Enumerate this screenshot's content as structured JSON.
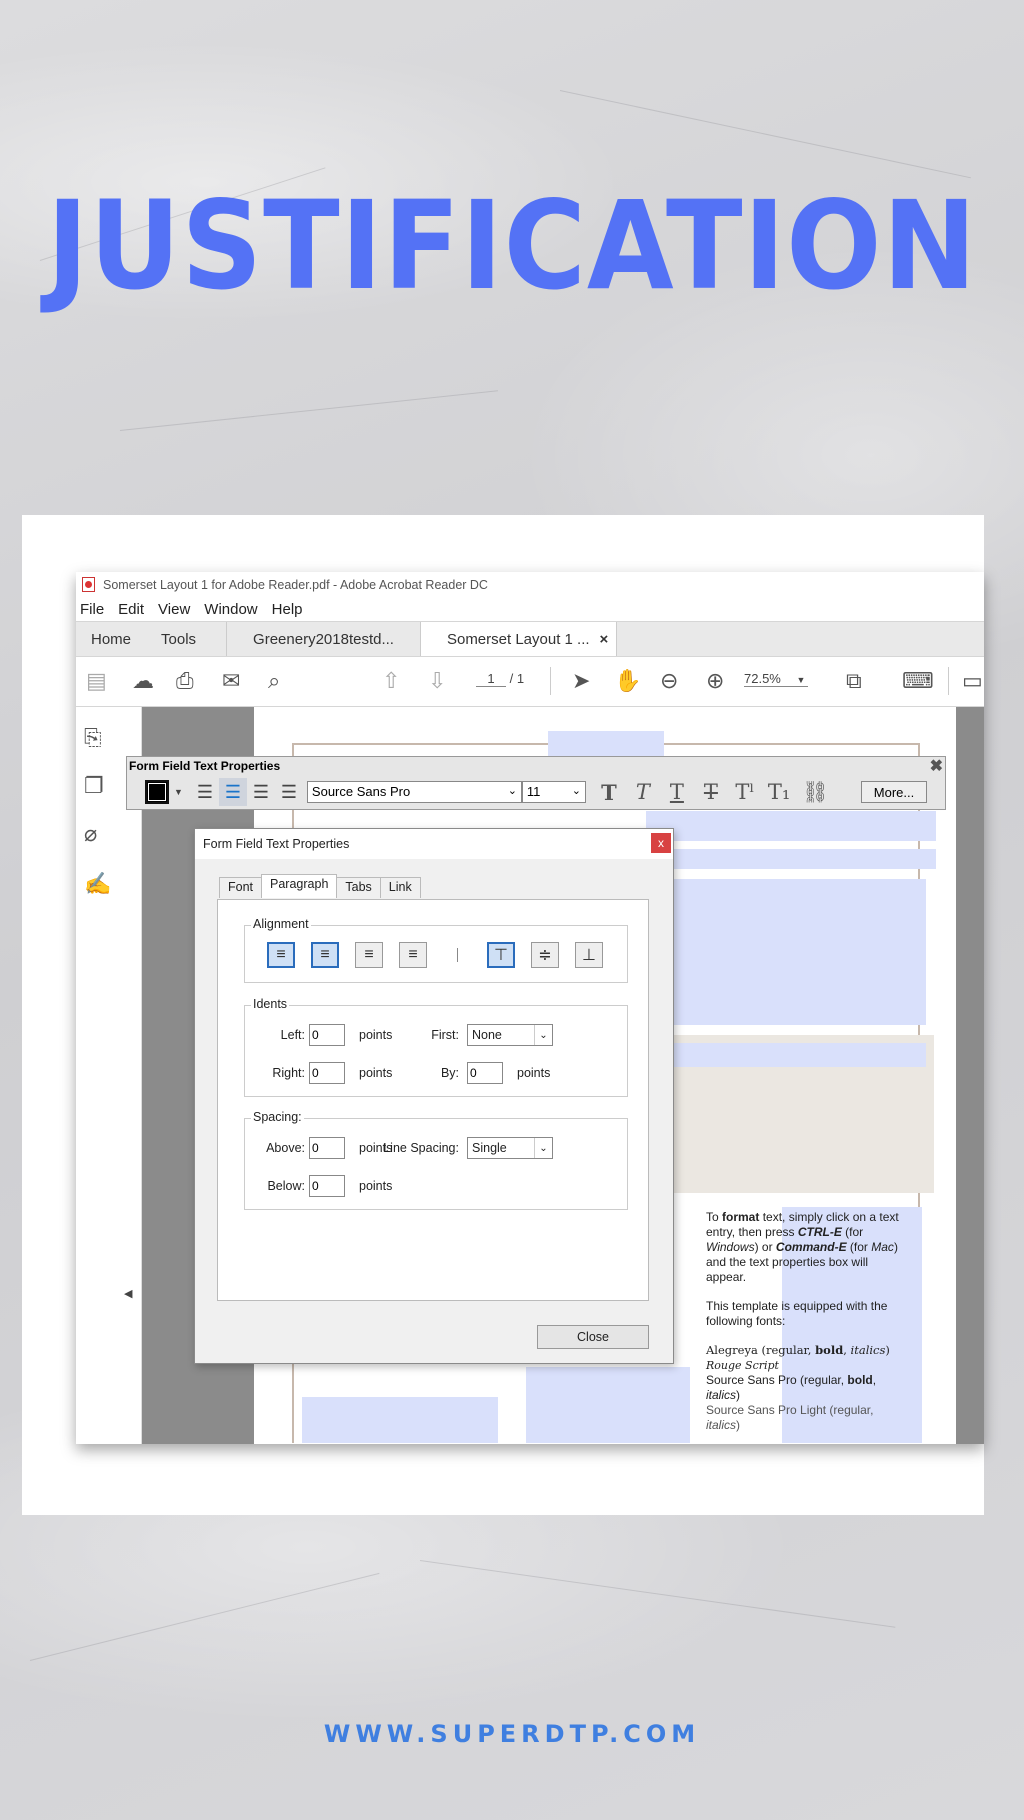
{
  "headline": "JUSTIFICATION",
  "footer_url": "WWW.SUPERDTP.COM",
  "colors": {
    "headline": "#5472f5",
    "footer": "#3f7fe0",
    "accent_blue": "#1a73c9",
    "field_fill": "#d9e0fb"
  },
  "window": {
    "title": "Somerset Layout 1 for Adobe Reader.pdf - Adobe Acrobat Reader DC",
    "menu": [
      "File",
      "Edit",
      "View",
      "Window",
      "Help"
    ],
    "tabs": {
      "home": "Home",
      "tools": "Tools",
      "doc1": "Greenery2018testd...",
      "doc2": "Somerset Layout 1 ...",
      "close": "×"
    },
    "toolbar": {
      "page_current": "1",
      "page_total": "/ 1",
      "zoom": "72.5%"
    }
  },
  "text_toolbar": {
    "title": "Form Field Text Properties",
    "font": "Source Sans Pro",
    "size": "11",
    "more": "More..."
  },
  "dialog": {
    "title": "Form Field Text Properties",
    "tabs": [
      "Font",
      "Paragraph",
      "Tabs",
      "Link"
    ],
    "active_tab": "Paragraph",
    "alignment": {
      "caption": "Alignment"
    },
    "indents": {
      "caption": "Idents",
      "left_label": "Left:",
      "left_value": "0",
      "right_label": "Right:",
      "right_value": "0",
      "first_label": "First:",
      "first_value": "None",
      "by_label": "By:",
      "by_value": "0",
      "unit": "points"
    },
    "spacing": {
      "caption": "Spacing:",
      "above_label": "Above:",
      "above_value": "0",
      "below_label": "Below:",
      "below_value": "0",
      "line_spacing_label": "Line Spacing:",
      "line_spacing_value": "Single",
      "unit": "points"
    },
    "close": "Close"
  },
  "note": {
    "p1_a": "To ",
    "p1_b": "format",
    "p1_c": " text, simply click on a text entry, then press ",
    "p1_d": "CTRL-E",
    "p1_e": " (for ",
    "p1_f": "Windows",
    "p1_g": ") or ",
    "p1_h": "Command-E",
    "p1_i": " (for ",
    "p1_j": "Mac",
    "p1_k": ") and the text properties box will appear.",
    "p2": "This template is equipped with the following fonts:",
    "f1_a": "Alegreya (regular, ",
    "f1_b": "bold",
    "f1_c": ", ",
    "f1_d": "italics",
    "f1_e": ")",
    "f2": "Rouge Script",
    "f3_a": "Source Sans Pro (regular, ",
    "f3_b": "bold",
    "f3_c": ", ",
    "f3_d": "italics",
    "f3_e": ")",
    "f4_a": "Source Sans Pro Light (regular, ",
    "f4_b": "italics",
    "f4_c": ")"
  }
}
